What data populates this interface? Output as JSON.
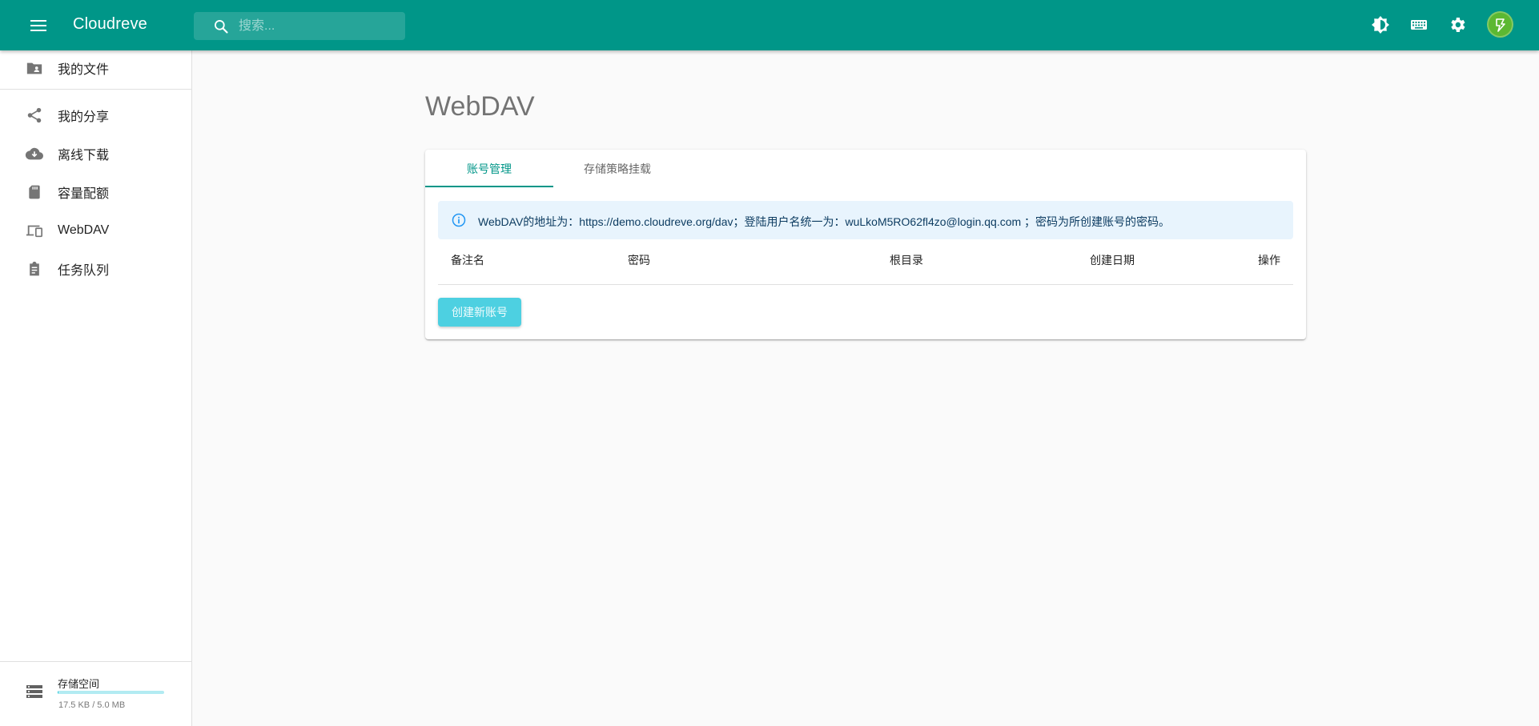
{
  "appbar": {
    "title": "Cloudreve",
    "search_placeholder": "搜索...",
    "brand_color": "#009688",
    "icons": [
      "menu-icon",
      "search-icon",
      "theme-toggle-icon",
      "keyboard-icon",
      "settings-icon",
      "avatar"
    ]
  },
  "sidebar": {
    "items": [
      {
        "label": "我的文件",
        "icon": "folder-shared-icon"
      },
      {
        "label": "我的分享",
        "icon": "share-icon"
      },
      {
        "label": "离线下载",
        "icon": "cloud-download-icon"
      },
      {
        "label": "容量配额",
        "icon": "sd-card-icon"
      },
      {
        "label": "WebDAV",
        "icon": "devices-icon"
      },
      {
        "label": "任务队列",
        "icon": "assignment-icon"
      }
    ],
    "storage": {
      "title": "存储空间",
      "usage": "17.5 KB / 5.0 MB",
      "used_fraction": 0.0035
    }
  },
  "main": {
    "title": "WebDAV",
    "tabs": [
      {
        "label": "账号管理",
        "active": true
      },
      {
        "label": "存储策略挂载",
        "active": false
      }
    ],
    "alert": "WebDAV的地址为：https://demo.cloudreve.org/dav；登陆用户名统一为：wuLkoM5RO62fl4zo@login.qq.com ；密码为所创建账号的密码。",
    "table": {
      "headers": [
        "备注名",
        "密码",
        "根目录",
        "创建日期",
        "操作"
      ]
    },
    "create_button": "创建新账号"
  }
}
